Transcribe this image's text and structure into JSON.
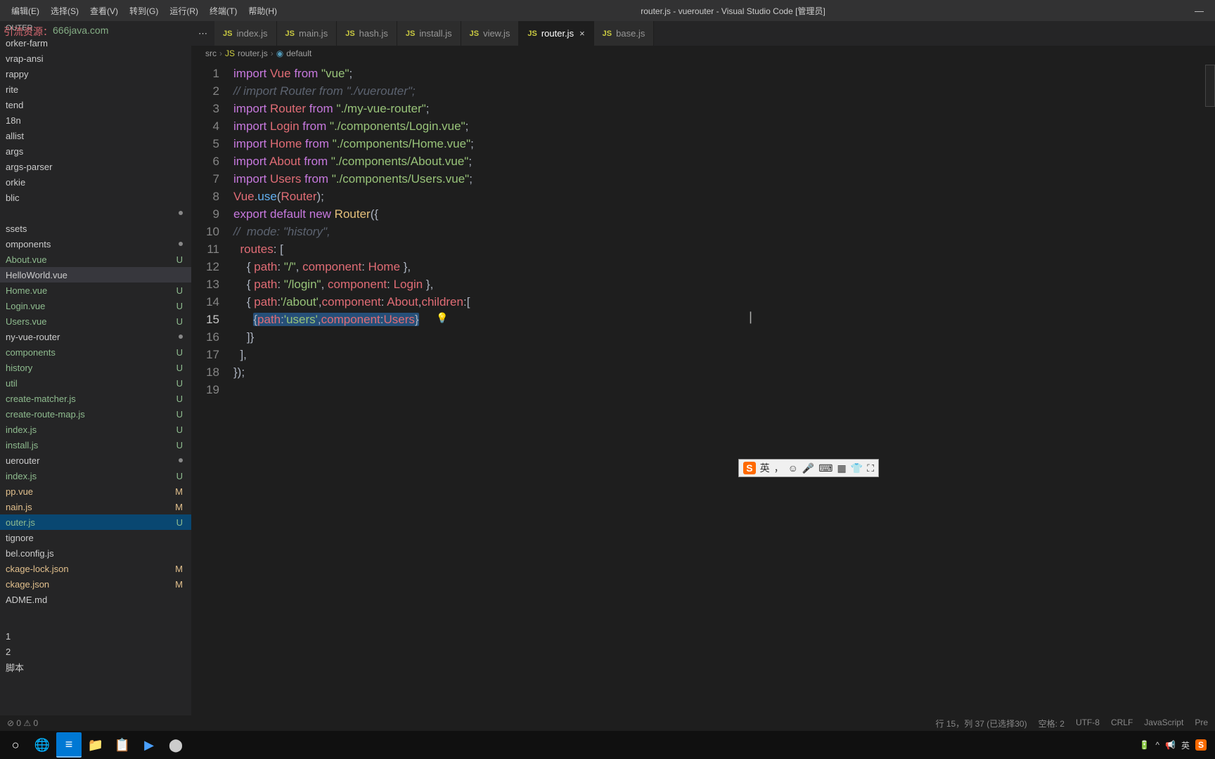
{
  "titlebar": {
    "menus": [
      "编辑(E)",
      "选择(S)",
      "查看(V)",
      "转到(G)",
      "运行(R)",
      "终端(T)",
      "帮助(H)"
    ],
    "title": "router.js - vuerouter - Visual Studio Code [管理员]"
  },
  "watermark": {
    "label1": "引流资源：",
    "label2": "666java.com"
  },
  "sidebar": {
    "header": "OUTER",
    "items": [
      {
        "label": "orker-farm",
        "status": "",
        "class": ""
      },
      {
        "label": "vrap-ansi",
        "status": "",
        "class": ""
      },
      {
        "label": "rappy",
        "status": "",
        "class": ""
      },
      {
        "label": "rite",
        "status": "",
        "class": ""
      },
      {
        "label": "tend",
        "status": "",
        "class": ""
      },
      {
        "label": "18n",
        "status": "",
        "class": ""
      },
      {
        "label": "allist",
        "status": "",
        "class": ""
      },
      {
        "label": "args",
        "status": "",
        "class": ""
      },
      {
        "label": "args-parser",
        "status": "",
        "class": ""
      },
      {
        "label": "orkie",
        "status": "",
        "class": ""
      },
      {
        "label": "blic",
        "status": "",
        "class": ""
      },
      {
        "label": "",
        "status": "dot",
        "class": ""
      },
      {
        "label": "ssets",
        "status": "",
        "class": ""
      },
      {
        "label": "omponents",
        "status": "dot",
        "class": ""
      },
      {
        "label": "About.vue",
        "status": "U",
        "class": "untracked"
      },
      {
        "label": "HelloWorld.vue",
        "status": "",
        "class": "selected"
      },
      {
        "label": "Home.vue",
        "status": "U",
        "class": "untracked"
      },
      {
        "label": "Login.vue",
        "status": "U",
        "class": "untracked"
      },
      {
        "label": "Users.vue",
        "status": "U",
        "class": "untracked"
      },
      {
        "label": "ny-vue-router",
        "status": "dot",
        "class": ""
      },
      {
        "label": "components",
        "status": "U",
        "class": "untracked"
      },
      {
        "label": "history",
        "status": "U",
        "class": "untracked"
      },
      {
        "label": "util",
        "status": "U",
        "class": "untracked"
      },
      {
        "label": "create-matcher.js",
        "status": "U",
        "class": "untracked"
      },
      {
        "label": "create-route-map.js",
        "status": "U",
        "class": "untracked"
      },
      {
        "label": "index.js",
        "status": "U",
        "class": "untracked"
      },
      {
        "label": "install.js",
        "status": "U",
        "class": "untracked"
      },
      {
        "label": "uerouter",
        "status": "dot",
        "class": ""
      },
      {
        "label": "index.js",
        "status": "U",
        "class": "untracked"
      },
      {
        "label": "pp.vue",
        "status": "M",
        "class": "modified"
      },
      {
        "label": "nain.js",
        "status": "M",
        "class": "modified"
      },
      {
        "label": "outer.js",
        "status": "U",
        "class": "highlighted untracked"
      },
      {
        "label": "tignore",
        "status": "",
        "class": ""
      },
      {
        "label": "bel.config.js",
        "status": "",
        "class": ""
      },
      {
        "label": "ckage-lock.json",
        "status": "M",
        "class": "modified"
      },
      {
        "label": "ckage.json",
        "status": "M",
        "class": "modified"
      },
      {
        "label": "ADME.md",
        "status": "",
        "class": ""
      }
    ],
    "outline_items": [
      "1",
      "2",
      "脚本"
    ],
    "problems": "⊘ 0 ⚠ 0"
  },
  "tabs": [
    {
      "icon": "JS",
      "label": "index.js",
      "active": false
    },
    {
      "icon": "JS",
      "label": "main.js",
      "active": false
    },
    {
      "icon": "JS",
      "label": "hash.js",
      "active": false
    },
    {
      "icon": "JS",
      "label": "install.js",
      "active": false
    },
    {
      "icon": "JS",
      "label": "view.js",
      "active": false
    },
    {
      "icon": "JS",
      "label": "router.js",
      "active": true
    },
    {
      "icon": "JS",
      "label": "base.js",
      "active": false
    }
  ],
  "breadcrumbs": [
    "src",
    "router.js",
    "default"
  ],
  "code": {
    "lines": [
      {
        "n": 1,
        "tokens": [
          {
            "t": "import ",
            "c": "kw-import"
          },
          {
            "t": "Vue",
            "c": "var-name"
          },
          {
            "t": " from ",
            "c": "kw-from"
          },
          {
            "t": "\"vue\"",
            "c": "string"
          },
          {
            "t": ";",
            "c": "punc"
          }
        ]
      },
      {
        "n": 2,
        "tokens": [
          {
            "t": "// import Router from \"./vuerouter\";",
            "c": "comment"
          }
        ]
      },
      {
        "n": 3,
        "tokens": [
          {
            "t": "import ",
            "c": "kw-import"
          },
          {
            "t": "Router",
            "c": "var-name"
          },
          {
            "t": " from ",
            "c": "kw-from"
          },
          {
            "t": "\"./my-vue-router\"",
            "c": "string"
          },
          {
            "t": ";",
            "c": "punc"
          }
        ]
      },
      {
        "n": 4,
        "tokens": [
          {
            "t": "import ",
            "c": "kw-import"
          },
          {
            "t": "Login",
            "c": "var-name"
          },
          {
            "t": " from ",
            "c": "kw-from"
          },
          {
            "t": "\"./components/Login.vue\"",
            "c": "string"
          },
          {
            "t": ";",
            "c": "punc"
          }
        ]
      },
      {
        "n": 5,
        "tokens": [
          {
            "t": "import ",
            "c": "kw-import"
          },
          {
            "t": "Home",
            "c": "var-name"
          },
          {
            "t": " from ",
            "c": "kw-from"
          },
          {
            "t": "\"./components/Home.vue\"",
            "c": "string"
          },
          {
            "t": ";",
            "c": "punc"
          }
        ]
      },
      {
        "n": 6,
        "tokens": [
          {
            "t": "import ",
            "c": "kw-import"
          },
          {
            "t": "About",
            "c": "var-name"
          },
          {
            "t": " from ",
            "c": "kw-from"
          },
          {
            "t": "\"./components/About.vue\"",
            "c": "string"
          },
          {
            "t": ";",
            "c": "punc"
          }
        ]
      },
      {
        "n": 7,
        "tokens": [
          {
            "t": "import ",
            "c": "kw-import"
          },
          {
            "t": "Users",
            "c": "var-name"
          },
          {
            "t": " from ",
            "c": "kw-from"
          },
          {
            "t": "\"./components/Users.vue\"",
            "c": "string"
          },
          {
            "t": ";",
            "c": "punc"
          }
        ]
      },
      {
        "n": 8,
        "tokens": [
          {
            "t": "Vue",
            "c": "var-name"
          },
          {
            "t": ".",
            "c": "punc"
          },
          {
            "t": "use",
            "c": "method"
          },
          {
            "t": "(",
            "c": "punc"
          },
          {
            "t": "Router",
            "c": "var-name"
          },
          {
            "t": ");",
            "c": "punc"
          }
        ]
      },
      {
        "n": 9,
        "tokens": [
          {
            "t": "export ",
            "c": "kw-import"
          },
          {
            "t": "default ",
            "c": "kw-import"
          },
          {
            "t": "new ",
            "c": "new-kw"
          },
          {
            "t": "Router",
            "c": "class-name"
          },
          {
            "t": "({",
            "c": "punc"
          }
        ]
      },
      {
        "n": 10,
        "tokens": [
          {
            "t": "//  mode: \"history\",",
            "c": "comment"
          }
        ]
      },
      {
        "n": 11,
        "tokens": [
          {
            "t": "  ",
            "c": "punc"
          },
          {
            "t": "routes",
            "c": "prop"
          },
          {
            "t": ": [",
            "c": "punc"
          }
        ]
      },
      {
        "n": 12,
        "tokens": [
          {
            "t": "    { ",
            "c": "punc"
          },
          {
            "t": "path",
            "c": "prop"
          },
          {
            "t": ": ",
            "c": "punc"
          },
          {
            "t": "\"/\"",
            "c": "string"
          },
          {
            "t": ", ",
            "c": "punc"
          },
          {
            "t": "component",
            "c": "prop"
          },
          {
            "t": ": ",
            "c": "punc"
          },
          {
            "t": "Home",
            "c": "var-name"
          },
          {
            "t": " },",
            "c": "punc"
          }
        ]
      },
      {
        "n": 13,
        "tokens": [
          {
            "t": "    { ",
            "c": "punc"
          },
          {
            "t": "path",
            "c": "prop"
          },
          {
            "t": ": ",
            "c": "punc"
          },
          {
            "t": "\"/login\"",
            "c": "string"
          },
          {
            "t": ", ",
            "c": "punc"
          },
          {
            "t": "component",
            "c": "prop"
          },
          {
            "t": ": ",
            "c": "punc"
          },
          {
            "t": "Login",
            "c": "var-name"
          },
          {
            "t": " },",
            "c": "punc"
          }
        ]
      },
      {
        "n": 14,
        "tokens": [
          {
            "t": "    { ",
            "c": "punc"
          },
          {
            "t": "path",
            "c": "prop"
          },
          {
            "t": ":",
            "c": "punc"
          },
          {
            "t": "'/about'",
            "c": "string"
          },
          {
            "t": ",",
            "c": "punc"
          },
          {
            "t": "component",
            "c": "prop"
          },
          {
            "t": ": ",
            "c": "punc"
          },
          {
            "t": "About",
            "c": "var-name"
          },
          {
            "t": ",",
            "c": "punc"
          },
          {
            "t": "children",
            "c": "prop"
          },
          {
            "t": ":[",
            "c": "punc"
          }
        ]
      },
      {
        "n": 15,
        "tokens": [
          {
            "t": "      ",
            "c": "punc"
          }
        ],
        "sel": [
          {
            "t": "{",
            "c": "punc"
          },
          {
            "t": "path",
            "c": "prop"
          },
          {
            "t": ":",
            "c": "punc"
          },
          {
            "t": "'users'",
            "c": "string"
          },
          {
            "t": ",",
            "c": "punc"
          },
          {
            "t": "component",
            "c": "prop"
          },
          {
            "t": ":",
            "c": "punc"
          },
          {
            "t": "Users",
            "c": "var-name"
          },
          {
            "t": "}",
            "c": "punc"
          }
        ]
      },
      {
        "n": 16,
        "tokens": [
          {
            "t": "    ]}",
            "c": "punc"
          }
        ]
      },
      {
        "n": 17,
        "tokens": [
          {
            "t": "  ],",
            "c": "punc"
          }
        ]
      },
      {
        "n": 18,
        "tokens": [
          {
            "t": "});",
            "c": "punc"
          }
        ]
      },
      {
        "n": 19,
        "tokens": []
      }
    ]
  },
  "statusbar": {
    "left_problems": "⊘ 0 ⚠ 0",
    "right": [
      "行 15，列 37 (已选择30)",
      "空格: 2",
      "UTF-8",
      "CRLF",
      "JavaScript",
      "Pre"
    ]
  },
  "ime": {
    "s": "S",
    "chars": [
      "英",
      "：",
      "☺",
      "⌨",
      "🎤",
      "⌨",
      "▦",
      "⬆",
      "⛶"
    ]
  },
  "taskbar": {
    "tray": [
      "^",
      "📢",
      "英"
    ]
  }
}
